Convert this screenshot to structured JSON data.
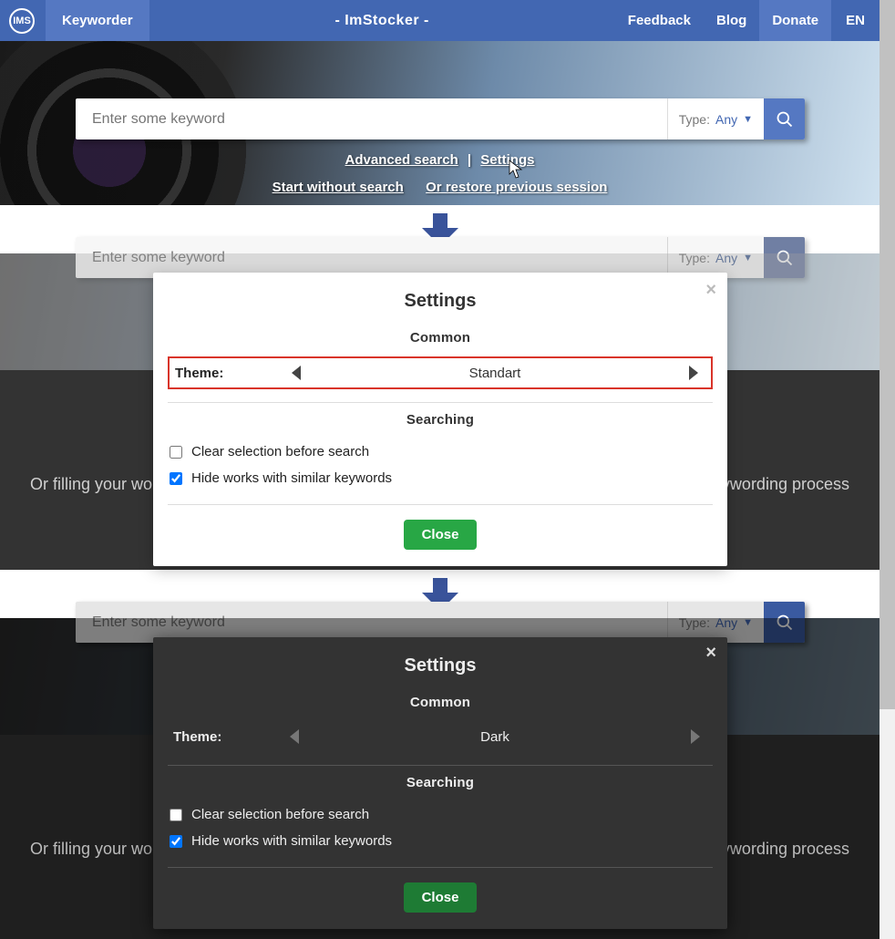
{
  "nav": {
    "logo_text": "IMS",
    "keyworder": "Keyworder",
    "title": "- ImStocker -",
    "feedback": "Feedback",
    "blog": "Blog",
    "donate": "Donate",
    "lang": "EN"
  },
  "search": {
    "placeholder": "Enter some keyword",
    "type_label": "Type:",
    "type_value": "Any"
  },
  "hero_links": {
    "advanced": "Advanced search",
    "sep": "|",
    "settings": "Settings",
    "start": "Start without search",
    "restore": "Or restore previous session"
  },
  "bg_text": {
    "left": "Or filling your wor",
    "right": "eywording process"
  },
  "modal_light": {
    "title": "Settings",
    "common": "Common",
    "theme_label": "Theme:",
    "theme_value": "Standart",
    "searching": "Searching",
    "opt_clear": "Clear selection before search",
    "opt_hide": "Hide works with similar keywords",
    "close": "Close"
  },
  "modal_dark": {
    "title": "Settings",
    "common": "Common",
    "theme_label": "Theme:",
    "theme_value": "Dark",
    "searching": "Searching",
    "opt_clear": "Clear selection before search",
    "opt_hide": "Hide works with similar keywords",
    "close": "Close"
  }
}
